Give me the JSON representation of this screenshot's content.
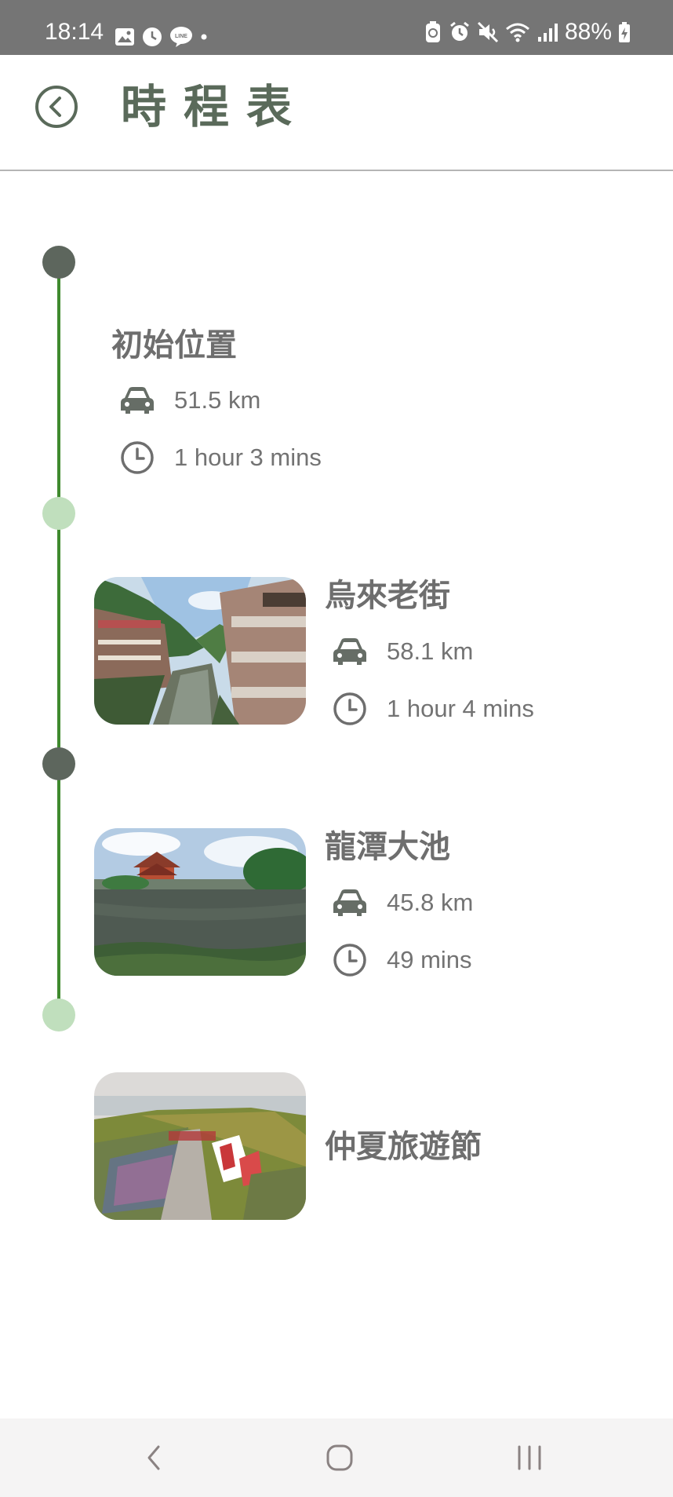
{
  "status_bar": {
    "time": "18:14",
    "left_icons": [
      "image-icon",
      "clock-status-icon",
      "line-app-icon",
      "dot-icon"
    ],
    "right_icons": [
      "battery-saver-icon",
      "alarm-icon",
      "mute-icon",
      "wifi-icon",
      "signal-icon"
    ],
    "battery": "88%"
  },
  "header": {
    "title": "時程表",
    "back_icon": "back-circle-icon"
  },
  "timeline": {
    "line_color": "#3f8a2e",
    "node_dark_color": "#5d665d",
    "node_light_color": "#c0dfbd",
    "stops": [
      {
        "name": "初始位置",
        "distance": "51.5 km",
        "duration": "1 hour 3 mins",
        "has_image": false
      },
      {
        "name": "烏來老街",
        "distance": "58.1 km",
        "duration": "1 hour 4 mins",
        "has_image": true
      },
      {
        "name": "龍潭大池",
        "distance": "45.8 km",
        "duration": "49 mins",
        "has_image": true
      },
      {
        "name": "仲夏旅遊節",
        "has_image": true
      }
    ]
  },
  "nav_bar": {
    "icons": [
      "nav-back-icon",
      "nav-home-icon",
      "nav-recents-icon"
    ]
  }
}
